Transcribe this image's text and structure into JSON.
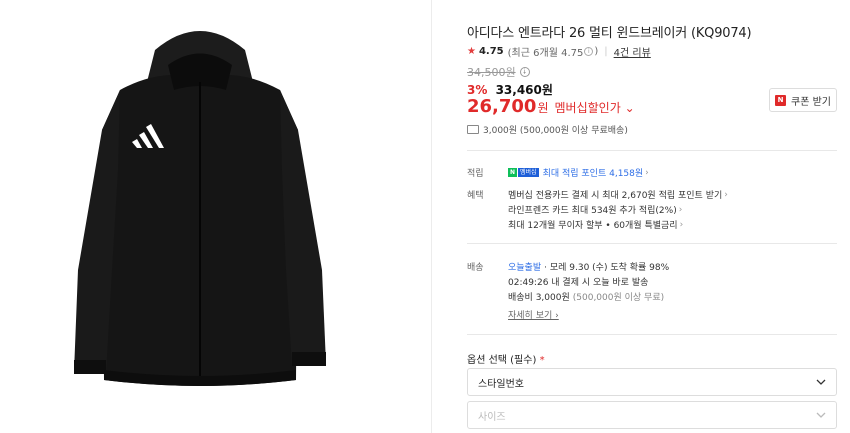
{
  "product": {
    "title": "아디다스 엔트라다 26 멀티 윈드브레이커 (KQ9074)",
    "rating": "4.75",
    "rating_recent": "(최근 6개월 4.75",
    "rating_recent_close": ")",
    "reviews": "4건 리뷰",
    "original_price": "34,500원",
    "discount_percent": "3%",
    "sale_price": "33,460원",
    "member_price": "26,700",
    "member_price_unit": "원",
    "member_label": "멤버십할인가 ⌄",
    "coupon_label": "쿠폰 받기",
    "coupon_badge": "N",
    "shipping_summary": "3,000원 (500,000원 이상 무료배송)"
  },
  "benefits": {
    "points_label": "적립",
    "points_badge_n": "N",
    "points_badge_plus": "멤버십",
    "points_text": "최대 적립 포인트 4,158원",
    "benefit_label": "혜택",
    "benefit_items": [
      "멤버십 전용카드 결제 시 최대 2,670원 적립 포인트 받기",
      "라인프렌즈 카드 최대 534원 추가 적립(2%)",
      "최대 12개월 무이자 할부 • 60개월 특별금리"
    ]
  },
  "delivery": {
    "label": "배송",
    "type": "오늘출발",
    "arrival": "· 모레 9.30 (수) 도착 확률 98%",
    "cutoff": "02:49:26  내 결제 시 오늘 바로 발송",
    "fee": "배송비 3,000원",
    "fee_note": "(500,000원 이상 무료)",
    "detail_link": "자세히 보기 ›"
  },
  "options": {
    "label": "옵션 선택 (필수)",
    "required_mark": "*",
    "select1": "스타일번호",
    "select2": "사이즈"
  },
  "colors": {
    "accent_red": "#e02a2a",
    "link_blue": "#2e6ee6",
    "naver_green": "#0fbf5a"
  },
  "icons": [
    "star-icon",
    "info-icon",
    "truck-icon",
    "chevron-right-icon",
    "chevron-down-icon",
    "adidas-logo-icon"
  ]
}
